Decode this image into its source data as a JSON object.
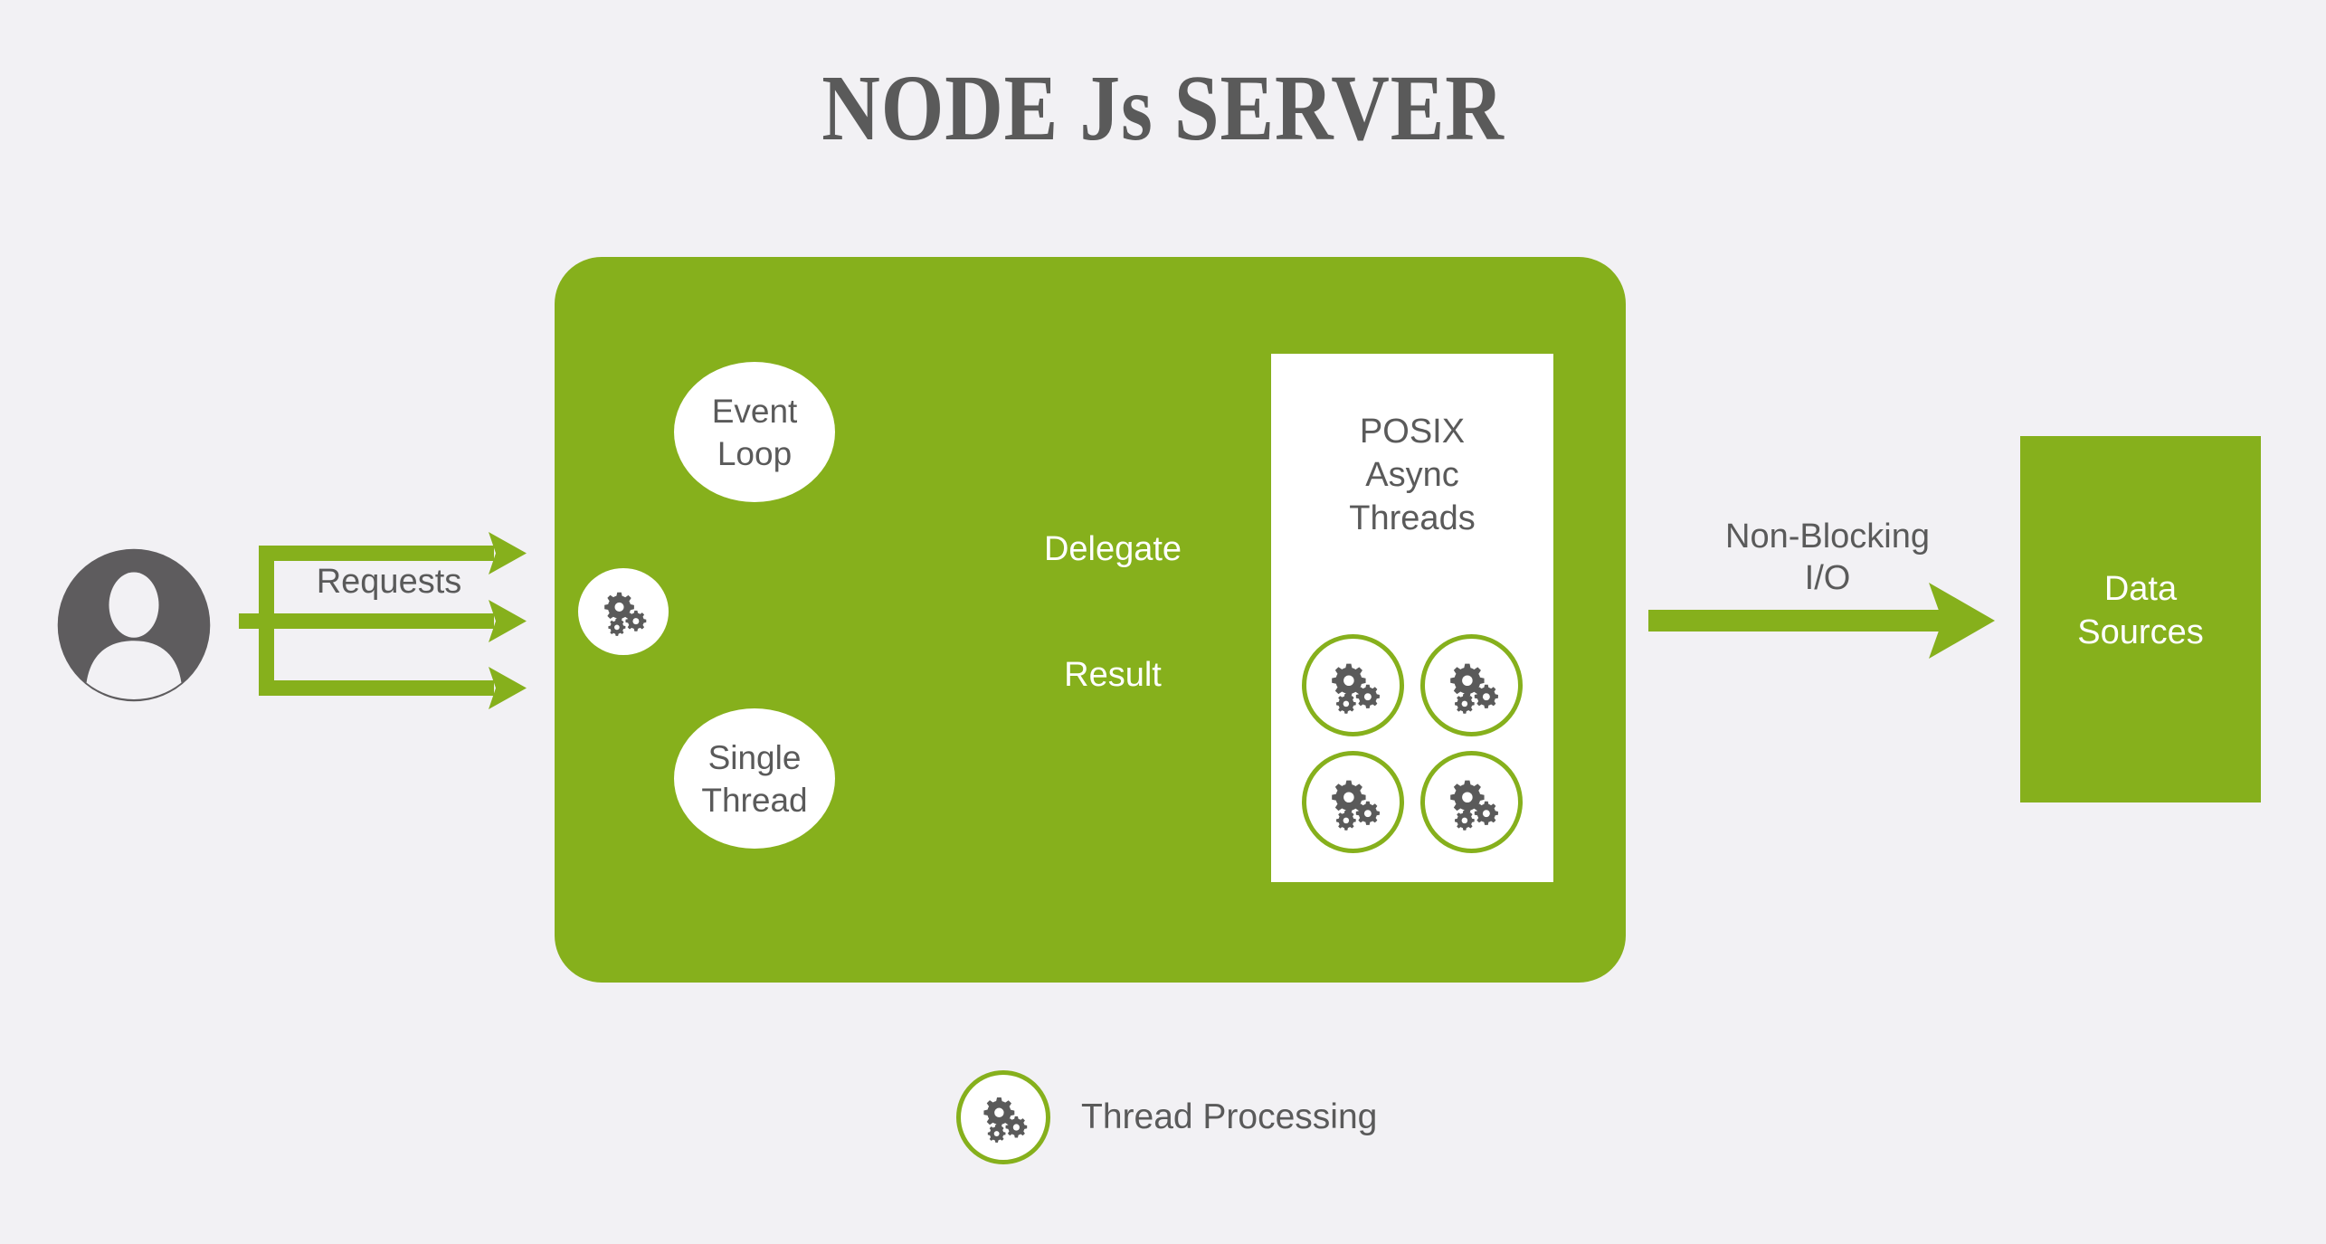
{
  "diagram": {
    "title": "NODE Js SERVER",
    "background_color": "#f2f1f4",
    "accent_green": "#86b01c",
    "text_gray": "#5a5a5a"
  },
  "client": {
    "avatar_icon": "user-avatar-icon",
    "requests_label": "Requests"
  },
  "server": {
    "event_loop_label": "Event\nLoop",
    "single_thread_label": "Single\nThread",
    "gear_icon": "gears-icon",
    "delegate_label": "Delegate",
    "result_label": "Result"
  },
  "posix": {
    "title": "POSIX\nAsync\nThreads",
    "threads": [
      {
        "icon": "gears-icon"
      },
      {
        "icon": "gears-icon"
      },
      {
        "icon": "gears-icon"
      },
      {
        "icon": "gears-icon"
      }
    ]
  },
  "io": {
    "non_blocking_label": "Non-Blocking\nI/O"
  },
  "data_sources": {
    "label": "Data\nSources"
  },
  "legend": {
    "icon": "gears-icon",
    "label": "Thread Processing"
  }
}
